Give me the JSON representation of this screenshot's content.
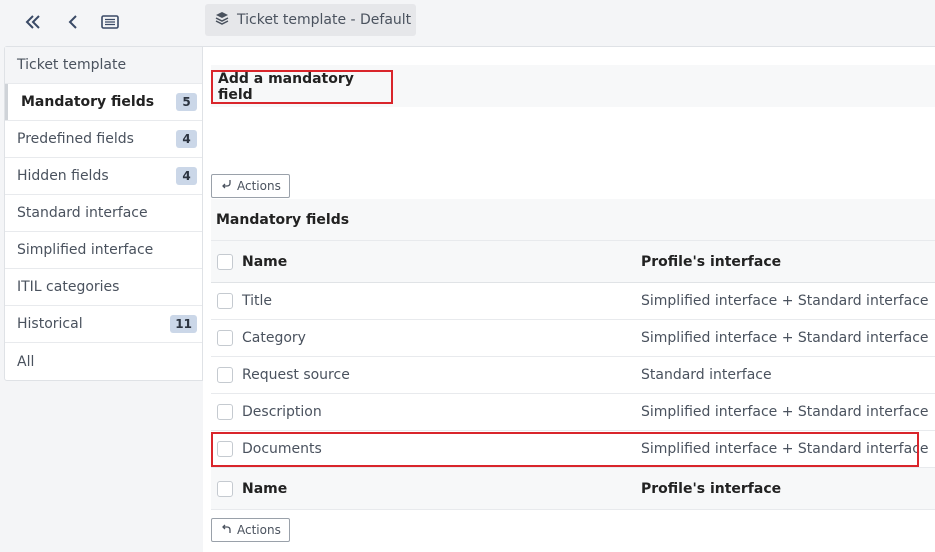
{
  "nav": {
    "collapse_icon": "double-chevron-left-icon",
    "back_icon": "chevron-left-icon",
    "list_icon": "list-view-icon"
  },
  "breadcrumb": {
    "icon": "layers-icon",
    "label": "Ticket template - Default"
  },
  "sidebar": {
    "items": [
      {
        "label": "Ticket template",
        "badge": null
      },
      {
        "label": "Mandatory fields",
        "badge": "5"
      },
      {
        "label": "Predefined fields",
        "badge": "4"
      },
      {
        "label": "Hidden fields",
        "badge": "4"
      },
      {
        "label": "Standard interface",
        "badge": null
      },
      {
        "label": "Simplified interface",
        "badge": null
      },
      {
        "label": "ITIL categories",
        "badge": null
      },
      {
        "label": "Historical",
        "badge": "11"
      },
      {
        "label": "All",
        "badge": null
      }
    ]
  },
  "main": {
    "add_title": "Add a mandatory field",
    "actions_label": "Actions",
    "table": {
      "caption": "Mandatory fields",
      "columns": [
        "Name",
        "Profile's interface"
      ],
      "rows": [
        {
          "name": "Title",
          "profile": "Simplified interface + Standard interface"
        },
        {
          "name": "Category",
          "profile": "Simplified interface + Standard interface"
        },
        {
          "name": "Request source",
          "profile": "Standard interface"
        },
        {
          "name": "Description",
          "profile": "Simplified interface + Standard interface"
        },
        {
          "name": "Documents",
          "profile": "Simplified interface + Standard interface"
        }
      ]
    }
  },
  "colors": {
    "highlight": "#d9252b",
    "badge_bg": "#cbd7e8"
  }
}
